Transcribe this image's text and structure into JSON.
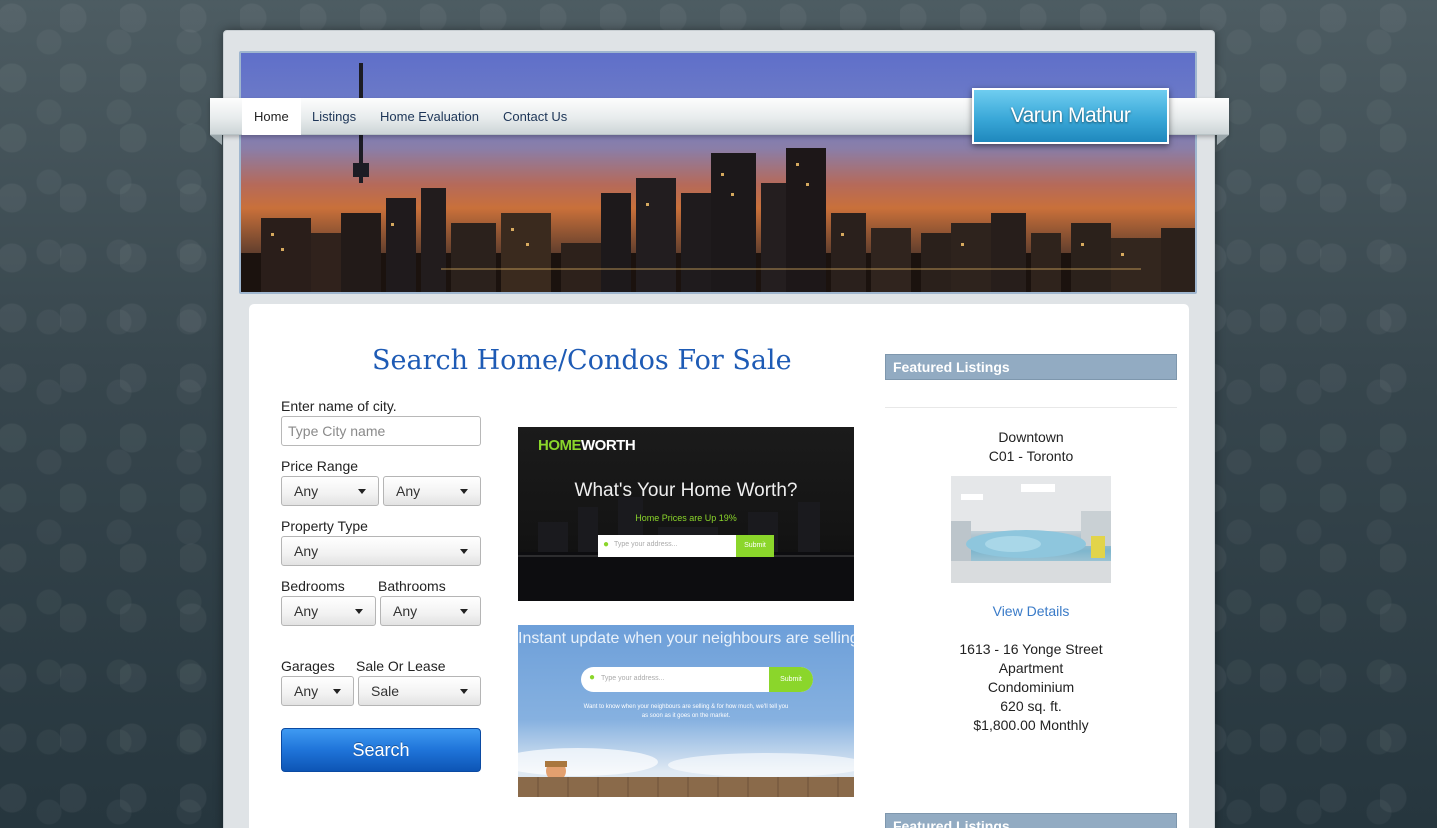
{
  "nav": {
    "items": [
      {
        "label": "Home",
        "active": true
      },
      {
        "label": "Listings"
      },
      {
        "label": "Home Evaluation"
      },
      {
        "label": "Contact Us"
      }
    ],
    "brand": "Varun Mathur"
  },
  "search": {
    "title": "Search Home/Condos For Sale",
    "city_label": "Enter name of city.",
    "city_placeholder": "Type City name",
    "price_label": "Price Range",
    "price_min": "Any",
    "price_max": "Any",
    "property_label": "Property Type",
    "property_value": "Any",
    "bedrooms_label": "Bedrooms",
    "bedrooms_value": "Any",
    "bathrooms_label": "Bathrooms",
    "bathrooms_value": "Any",
    "garages_label": "Garages",
    "garages_value": "Any",
    "sale_label": "Sale Or Lease",
    "sale_value": "Sale",
    "button": "Search"
  },
  "ads": {
    "homeworth": {
      "logo_a": "HOME",
      "logo_b": "WORTH",
      "headline": "What's Your Home Worth?",
      "sub": "Home Prices are Up 19%",
      "placeholder": "Type your address...",
      "submit": "Submit"
    },
    "neighbours": {
      "headline": "Instant update when your neighbours are selling!",
      "placeholder": "Type your address...",
      "submit": "Submit",
      "text1": "Want to know when your neighbours are selling & for how much, we'll tell you",
      "text2": "as soon as it goes on the market."
    }
  },
  "featured": {
    "heading": "Featured Listings",
    "area": "Downtown",
    "district": "C01 - Toronto",
    "view": "View Details",
    "address": "1613 - 16 Yonge Street",
    "type": "Apartment",
    "style": "Condominium",
    "size": "620 sq. ft.",
    "price": "$1,800.00 Monthly",
    "heading2": "Featured Listings"
  },
  "colors": {
    "accent": "#1e5bb5",
    "brand_box": "#3aa8d8",
    "featured_bar": "#92abc2",
    "search_button": "#1f74d9"
  }
}
